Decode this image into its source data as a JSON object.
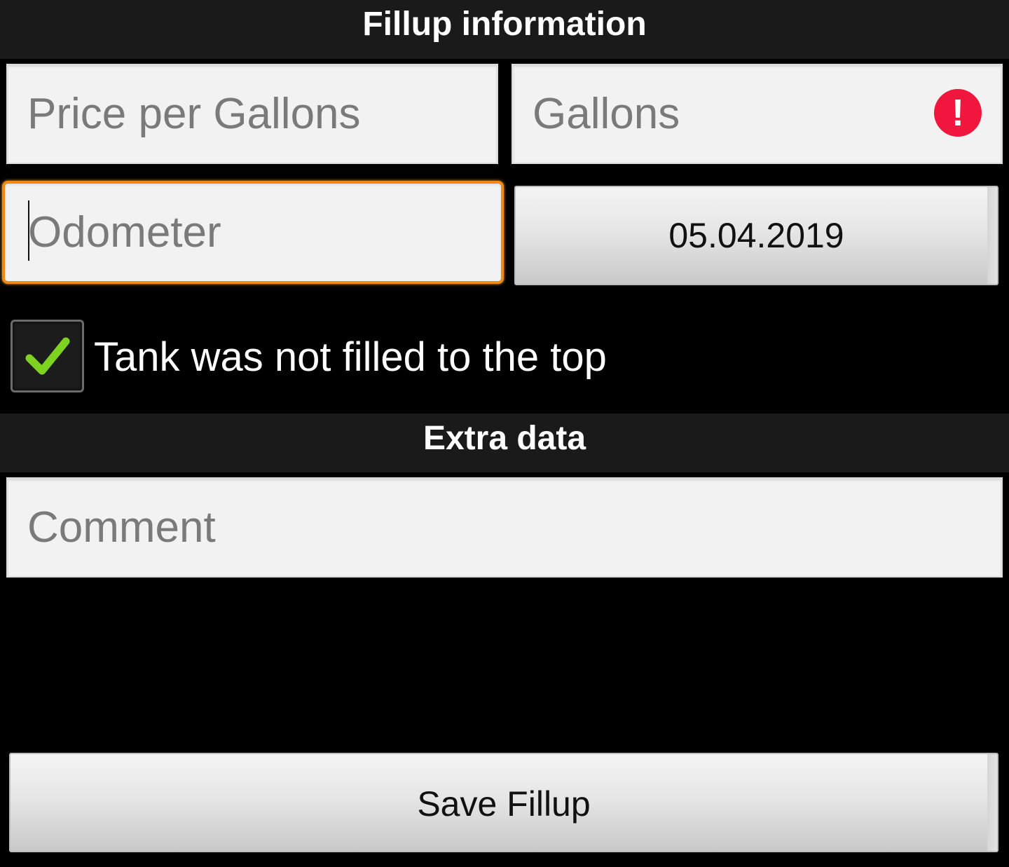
{
  "sections": {
    "fillup_title": "Fillup information",
    "extra_title": "Extra data"
  },
  "fields": {
    "price_placeholder": "Price per Gallons",
    "price_value": "",
    "gallons_placeholder": "Gallons",
    "gallons_value": "",
    "gallons_error_icon": "error-icon",
    "odometer_placeholder": "Odometer",
    "odometer_value": "",
    "comment_placeholder": "Comment",
    "comment_value": ""
  },
  "date_button": {
    "label": "05.04.2019"
  },
  "checkbox": {
    "checked": true,
    "label": "Tank was not filled to the top",
    "icon": "checkmark-icon"
  },
  "save_button": {
    "label": "Save Fillup"
  },
  "colors": {
    "header_bg": "#1a1a1a",
    "focus_border": "#f08a12",
    "error_red": "#f0163e",
    "check_green": "#7ed321"
  }
}
